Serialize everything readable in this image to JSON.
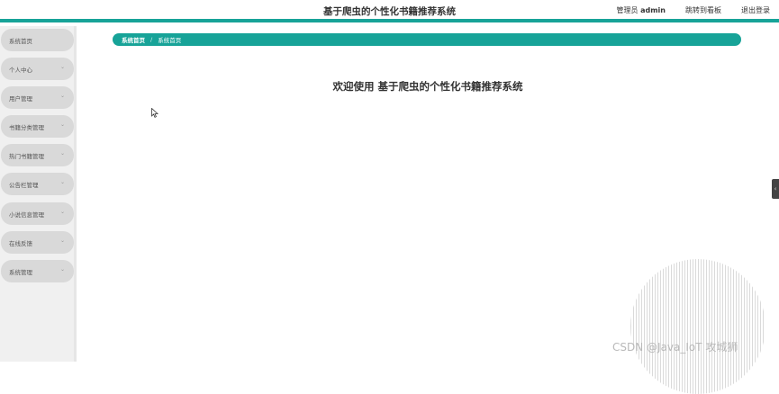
{
  "header": {
    "app_title": "基于爬虫的个性化书籍推荐系统",
    "admin_prefix": "管理员",
    "admin_name": "admin",
    "jump_label": "跳转到看板",
    "logout_label": "退出登录"
  },
  "sidebar": {
    "items": [
      {
        "label": "系统首页",
        "has_chevron": false
      },
      {
        "label": "个人中心",
        "has_chevron": true
      },
      {
        "label": "用户管理",
        "has_chevron": true
      },
      {
        "label": "书籍分类管理",
        "has_chevron": true
      },
      {
        "label": "热门书籍管理",
        "has_chevron": true
      },
      {
        "label": "公告栏管理",
        "has_chevron": true
      },
      {
        "label": "小说信息管理",
        "has_chevron": true
      },
      {
        "label": "在线反馈",
        "has_chevron": true
      },
      {
        "label": "系统管理",
        "has_chevron": true
      }
    ]
  },
  "breadcrumb": {
    "home": "系统首页",
    "separator": "/",
    "current": "系统首页"
  },
  "main": {
    "welcome": "欢迎使用 基于爬虫的个性化书籍推荐系统"
  },
  "watermark": {
    "text": "CSDN @Java_IoT 攻城狮"
  },
  "theme": {
    "accent": "#17a398"
  }
}
